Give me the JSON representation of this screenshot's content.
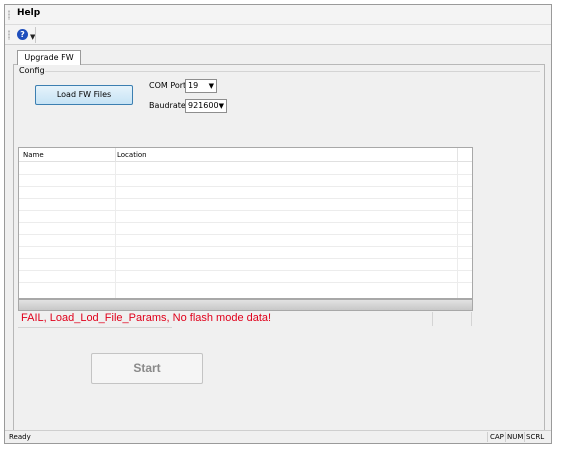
{
  "menu": {
    "help_label": "Help"
  },
  "toolbar": {
    "help_icon": "question-circle-icon",
    "overflow_icon": "chevron-down-icon"
  },
  "tabs": [
    {
      "label": "Upgrade FW"
    }
  ],
  "config": {
    "group_label": "Config",
    "load_button_label": "Load FW Files",
    "com_port_label": "COM Port:",
    "com_port_value": "19",
    "baudrate_label": "Baudrate:",
    "baudrate_value": "921600"
  },
  "file_list": {
    "columns": [
      "Name",
      "Location"
    ],
    "rows": []
  },
  "progress": {
    "value": 0
  },
  "status_message": "FAIL, Load_Lod_File_Params, No flash mode data!",
  "start_button_label": "Start",
  "statusbar": {
    "ready": "Ready",
    "indicators": [
      "CAP",
      "NUM",
      "SCRL"
    ]
  },
  "colors": {
    "error_text": "#e0001b",
    "button_accent": "#3c7fb1"
  }
}
